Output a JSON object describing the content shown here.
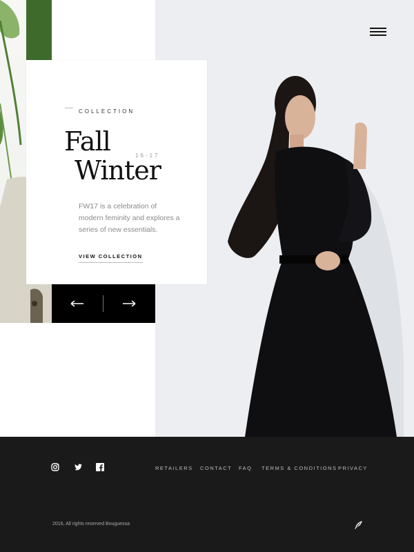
{
  "hero": {
    "eyebrow": "COLLECTION",
    "title_line1": "Fall",
    "title_line2": "Winter",
    "years": "16-17",
    "description": "FW17 is a celebration of modern feminity and explores a series of new essentials.",
    "cta": "VIEW COLLECTION"
  },
  "pager": {
    "prev_icon": "arrow-left-icon",
    "next_icon": "arrow-right-icon"
  },
  "footer": {
    "social": [
      "instagram-icon",
      "twitter-icon",
      "facebook-icon"
    ],
    "nav": [
      "RETAILERS",
      "CONTACT",
      "FAQ",
      "TERMS & CONDITIONS",
      "PRIVACY"
    ],
    "copyright": "2016, All rights reserved Bouguessa"
  },
  "colors": {
    "footer_bg": "#1a1a1a",
    "accent": "#000000",
    "text_muted": "#8a8a8a"
  }
}
